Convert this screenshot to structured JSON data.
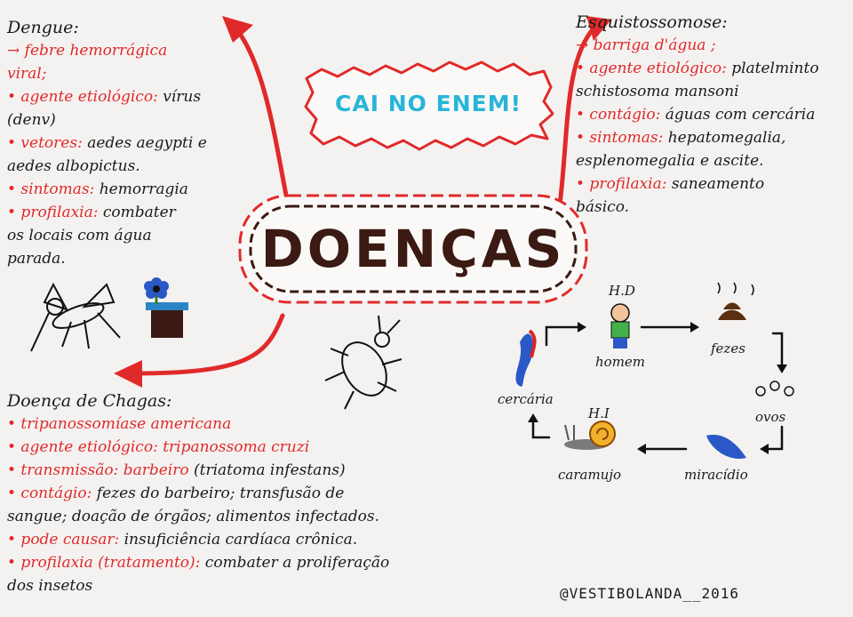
{
  "title": "DOENÇAS",
  "enem_badge": "CAI NO ENEM!",
  "dengue": {
    "title": "Dengue:",
    "lines": [
      {
        "key": "→ febre hemorrágica",
        "val": ""
      },
      {
        "key": "viral;",
        "val": ""
      },
      {
        "key": "• agente etiológico:",
        "val": " vírus"
      },
      {
        "key": "",
        "val": "(denv)"
      },
      {
        "key": "• vetores:",
        "val": " aedes aegypti e"
      },
      {
        "key": "",
        "val": "aedes albopictus."
      },
      {
        "key": "• sintomas:",
        "val": " hemorragia"
      },
      {
        "key": "• profilaxia:",
        "val": " combater"
      },
      {
        "key": "",
        "val": "os locais com água"
      },
      {
        "key": "",
        "val": "parada."
      }
    ]
  },
  "esquistossomose": {
    "title": "Esquistossomose:",
    "lines": [
      {
        "key": "→ barriga d'água ;",
        "val": ""
      },
      {
        "key": "• agente etiológico:",
        "val": " platelminto"
      },
      {
        "key": "",
        "val": "schistosoma mansoni"
      },
      {
        "key": "• contágio:",
        "val": " águas com cercária"
      },
      {
        "key": "• sintomas:",
        "val": " hepatomegalia,"
      },
      {
        "key": "",
        "val": "esplenomegalia e ascite."
      },
      {
        "key": "• profilaxia:",
        "val": " saneamento"
      },
      {
        "key": "",
        "val": "básico."
      }
    ]
  },
  "chagas": {
    "title": "Doença de Chagas:",
    "lines": [
      {
        "key": "• tripanossomíase americana",
        "val": ""
      },
      {
        "key": "• agente etiológico: tripanossoma cruzi",
        "val": ""
      },
      {
        "key": "• transmissão: barbeiro",
        "val": " (triatoma infestans)"
      },
      {
        "key": "• contágio:",
        "val": " fezes do barbeiro; transfusão de"
      },
      {
        "key": "",
        "val": "sangue; doação de órgãos; alimentos infectados."
      },
      {
        "key": "• pode causar:",
        "val": " insuficiência cardíaca crônica."
      },
      {
        "key": "• profilaxia (tratamento):",
        "val": " combater a proliferação"
      },
      {
        "key": "",
        "val": "dos insetos"
      }
    ]
  },
  "cycle": {
    "hd": "H.D",
    "homem": "homem",
    "fezes": "fezes",
    "ovos": "ovos",
    "miracidio": "miracídio",
    "caramujo": "caramujo",
    "hi": "H.I",
    "cercaria": "cercária"
  },
  "signature": "@VESTIBOLANDA__2016",
  "colors": {
    "accent": "#e02a2a",
    "dark": "#3a1a12",
    "cyan": "#27b5d8"
  }
}
